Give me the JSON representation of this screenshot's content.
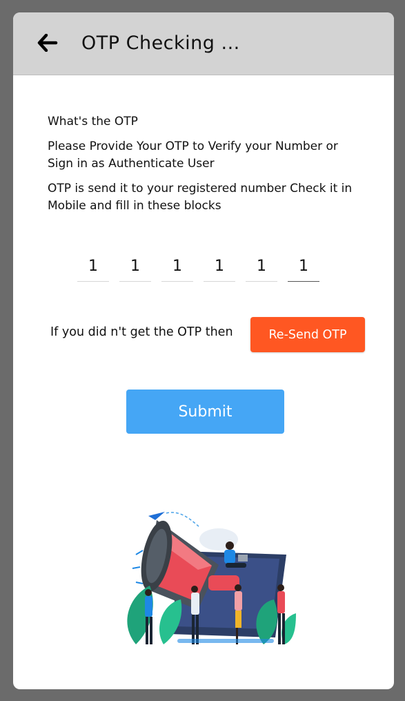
{
  "header": {
    "title": "OTP Checking ...",
    "back_icon": "arrow-left-icon"
  },
  "content": {
    "heading": "What's the OTP",
    "line1": "Please Provide Your OTP to Verify your Number or Sign in as Authenticate User",
    "line2": "OTP is send it to your registered number Check it in Mobile and fill in these blocks"
  },
  "otp": {
    "digits": [
      "1",
      "1",
      "1",
      "1",
      "1",
      "1"
    ],
    "active_index": 5
  },
  "resend": {
    "label": "If you did n't get the OTP then",
    "button": "Re-Send OTP"
  },
  "submit": {
    "label": "Submit"
  },
  "colors": {
    "header_bg": "#d3d3d3",
    "resend_bg": "#ff5722",
    "submit_bg": "#45a6f5",
    "page_bg": "#6b6b6b"
  }
}
